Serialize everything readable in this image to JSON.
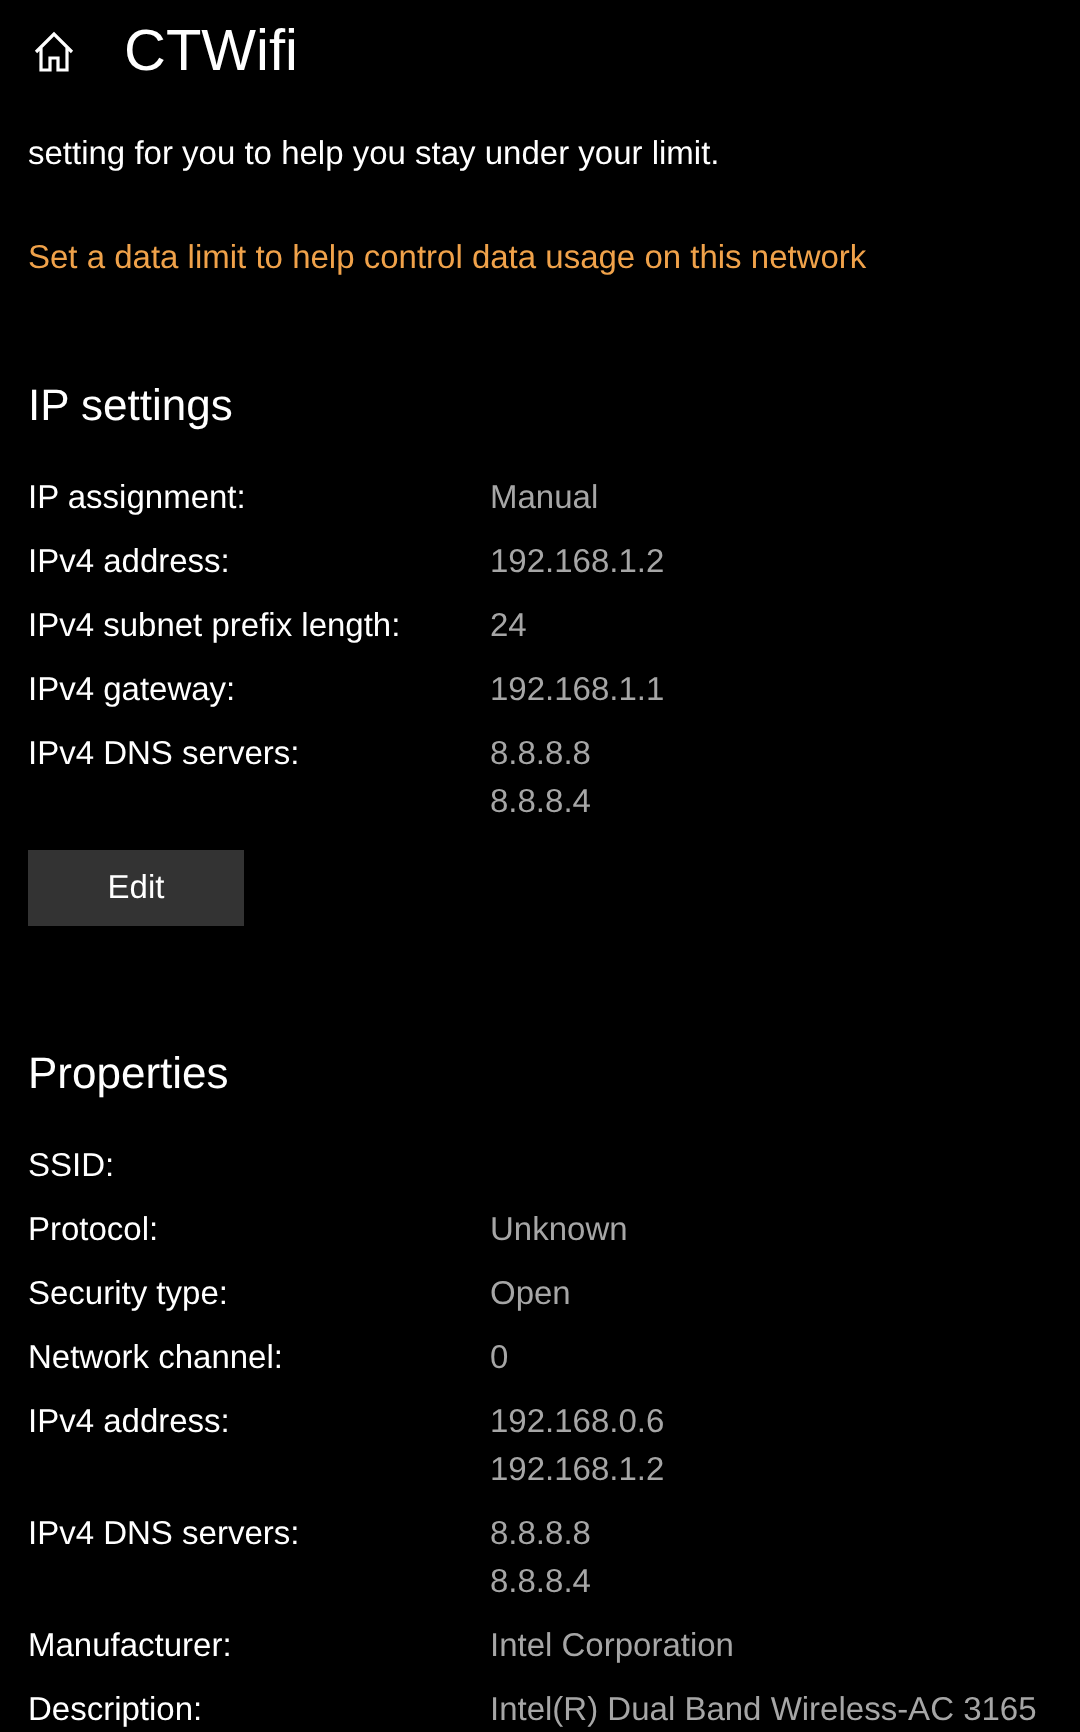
{
  "header": {
    "title": "CTWifi"
  },
  "intro": "setting for you to help you stay under your limit.",
  "link": "Set a data limit to help control data usage on this network",
  "sections": [
    {
      "title": "IP settings",
      "rows": [
        {
          "label": "IP assignment:",
          "values": [
            "Manual"
          ]
        },
        {
          "label": "IPv4 address:",
          "values": [
            "192.168.1.2"
          ]
        },
        {
          "label": "IPv4 subnet prefix length:",
          "values": [
            "24"
          ]
        },
        {
          "label": "IPv4 gateway:",
          "values": [
            "192.168.1.1"
          ]
        },
        {
          "label": "IPv4 DNS servers:",
          "values": [
            "8.8.8.8",
            "8.8.8.4"
          ]
        }
      ],
      "button": "Edit"
    },
    {
      "title": "Properties",
      "rows": [
        {
          "label": "SSID:",
          "values": []
        },
        {
          "label": "Protocol:",
          "values": [
            "Unknown"
          ]
        },
        {
          "label": "Security type:",
          "values": [
            "Open"
          ]
        },
        {
          "label": "Network channel:",
          "values": [
            "0"
          ]
        },
        {
          "label": "IPv4 address:",
          "values": [
            "192.168.0.6",
            "192.168.1.2"
          ]
        },
        {
          "label": "IPv4 DNS servers:",
          "values": [
            "8.8.8.8",
            "8.8.8.4"
          ]
        },
        {
          "label": "Manufacturer:",
          "values": [
            "Intel Corporation"
          ]
        },
        {
          "label": "Description:",
          "values": [
            "Intel(R) Dual Band Wireless-AC 3165"
          ]
        }
      ]
    }
  ]
}
